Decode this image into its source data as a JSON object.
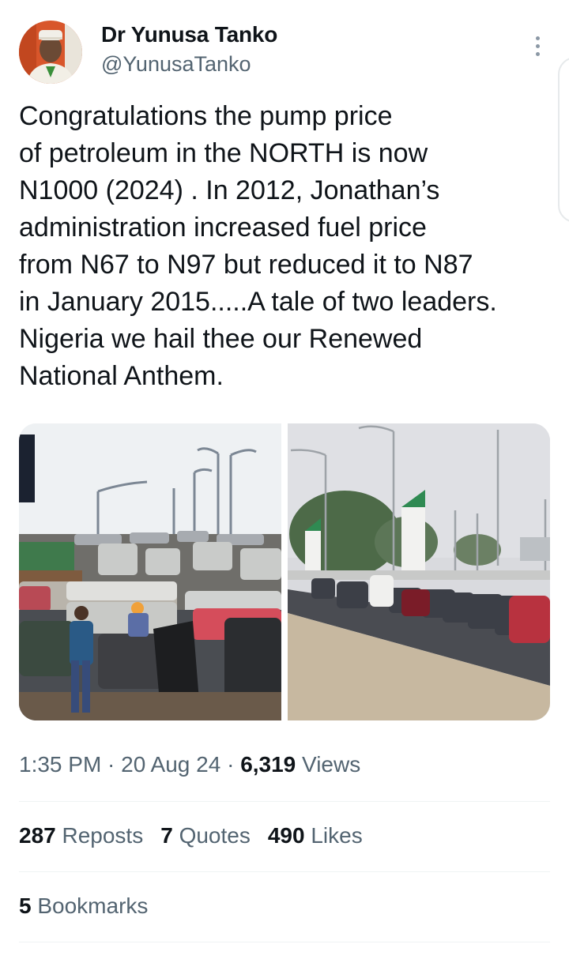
{
  "author": {
    "name": "Dr Yunusa Tanko",
    "handle": "@YunusaTanko"
  },
  "tweet": {
    "text": "Congratulations the pump price\nof petroleum in the NORTH is now\nN1000 (2024) . In 2012, Jonathan’s\nadministration increased fuel price\nfrom N67 to N97 but reduced it to N87\nin January 2015.....A tale of two leaders.\nNigeria we hail thee our Renewed\nNational Anthem."
  },
  "meta": {
    "time": "1:35 PM",
    "sep1": " · ",
    "date": "20 Aug 24",
    "sep2": " · ",
    "views_count": "6,319",
    "views_label": " Views"
  },
  "stats": {
    "reposts_count": "287",
    "reposts_label": " Reposts",
    "quotes_count": "7",
    "quotes_label": " Quotes",
    "likes_count": "490",
    "likes_label": " Likes",
    "bookmarks_count": "5",
    "bookmarks_label": " Bookmarks"
  },
  "icons": {
    "more": "more-vertical-icon"
  }
}
